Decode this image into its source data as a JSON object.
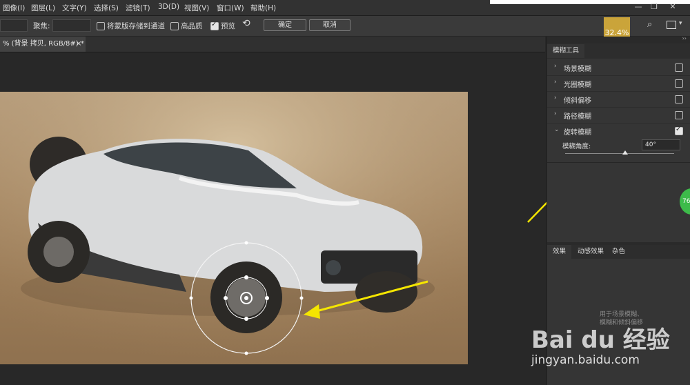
{
  "menu": [
    "图像(I)",
    "图层(L)",
    "文字(Y)",
    "选择(S)",
    "滤镜(T)",
    "3D(D)",
    "视图(V)",
    "窗口(W)",
    "帮助(H)"
  ],
  "window_controls": {
    "minimize": "—",
    "restore": "❐",
    "close": "✕"
  },
  "options": {
    "focus_label": "聚焦:",
    "save_mask_label": "将蒙版存储到通道",
    "high_quality_label": "高品质",
    "preview_label": "预览",
    "ok_label": "确定",
    "cancel_label": "取消",
    "zoom": "32.4%",
    "save_mask_checked": false,
    "high_quality_checked": false,
    "preview_checked": true
  },
  "document_tab": {
    "title": "% (背景 拷贝, RGB/8#) *",
    "close": "×"
  },
  "blur_panel": {
    "tab": "模糊工具",
    "items": [
      {
        "name": "场景模糊",
        "checked": false,
        "arrow": "›"
      },
      {
        "name": "光圈模糊",
        "checked": false,
        "arrow": "›"
      },
      {
        "name": "倾斜偏移",
        "checked": false,
        "arrow": "›"
      },
      {
        "name": "路径模糊",
        "checked": false,
        "arrow": "›"
      },
      {
        "name": "旋转模糊",
        "checked": true,
        "arrow": "⌄"
      }
    ],
    "angle_label": "模糊角度:",
    "angle_value": "40°",
    "angle_slider_fraction": 0.55
  },
  "effects_panel": {
    "tabs": [
      "效果",
      "动感效果",
      "杂色"
    ],
    "hint": "用于场景模糊、\n模糊和倾斜偏移"
  },
  "side_badge": "76",
  "watermark": {
    "brand": "Bai du 经验",
    "url": "jingyan.baidu.com"
  },
  "colors": {
    "zoom_bg": "#caa43a",
    "arrow": "#f5e600",
    "badge": "#3dbb4a"
  }
}
